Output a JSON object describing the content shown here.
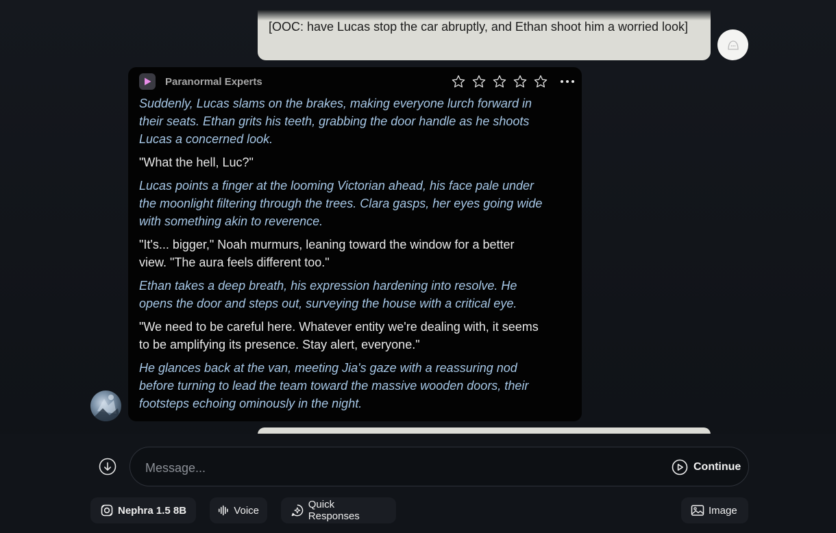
{
  "conversation": {
    "previous_user_message": "[OOC: have Lucas stop the car abruptly, and Ethan shoot him a worried look]",
    "bot_message": {
      "character_name": "Paranormal Experts",
      "rating_stars": 0,
      "max_stars": 5,
      "paragraphs": [
        {
          "style": "narration",
          "text": "Suddenly, Lucas slams on the brakes, making everyone lurch forward in their seats. Ethan grits his teeth, grabbing the door handle as he shoots Lucas a concerned look."
        },
        {
          "style": "speech",
          "text": "\"What the hell, Luc?\""
        },
        {
          "style": "narration",
          "text": "Lucas points a finger at the looming Victorian ahead, his face pale under the moonlight filtering through the trees. Clara gasps, her eyes going wide with something akin to reverence."
        },
        {
          "style": "speech",
          "text": "\"It's... bigger,\" Noah murmurs, leaning toward the window for a better view. \"The aura feels different too.\""
        },
        {
          "style": "narration",
          "text": "Ethan takes a deep breath, his expression hardening into resolve. He opens the door and steps out, surveying the house with a critical eye."
        },
        {
          "style": "speech",
          "text": "\"We need to be careful here. Whatever entity we're dealing with, it seems to be amplifying its presence. Stay alert, everyone.\""
        },
        {
          "style": "narration",
          "text": "He glances back at the van, meeting Jia's gaze with a reassuring nod before turning to lead the team toward the massive wooden doors, their footsteps echoing ominously in the night."
        }
      ]
    }
  },
  "composer": {
    "placeholder": "Message...",
    "continue_label": "Continue"
  },
  "toolbar": {
    "model_label": "Nephra 1.5 8B",
    "voice_label": "Voice",
    "quick_responses_label": "Quick Responses",
    "image_label": "Image"
  },
  "colors": {
    "narration": "#a6c7e6",
    "speech": "#e8e8e8",
    "user_bubble": "#dcdcd6",
    "bot_card": "#030303",
    "background": "#111419"
  },
  "icons": [
    "user-avatar-icon",
    "character-play-icon",
    "star-icon",
    "more-options-icon",
    "scroll-down-icon",
    "continue-play-icon",
    "model-icon",
    "voice-waveform-icon",
    "quick-responses-icon",
    "image-icon"
  ]
}
